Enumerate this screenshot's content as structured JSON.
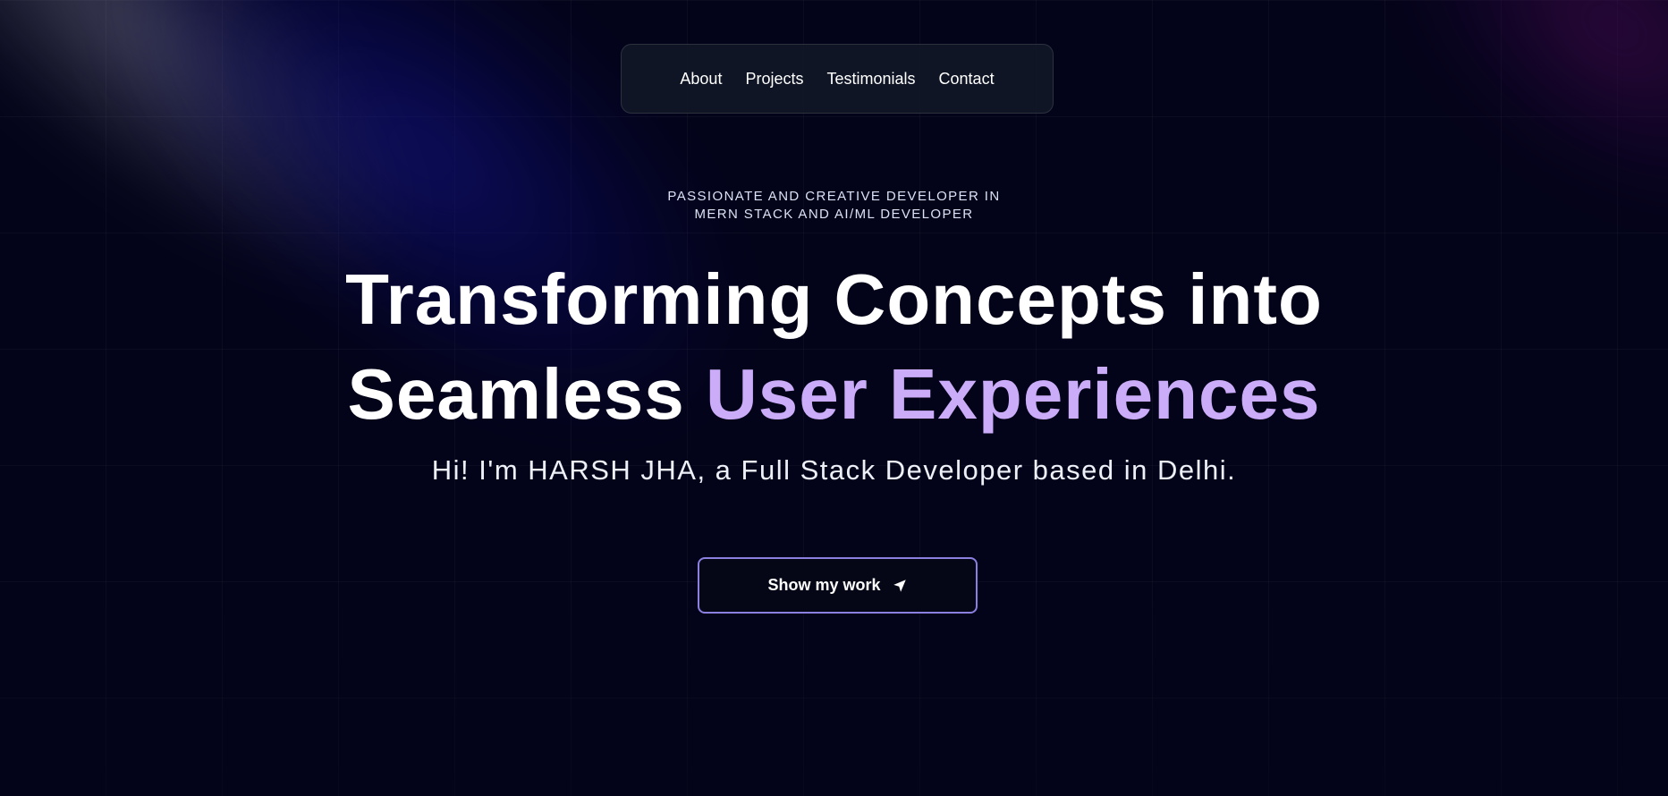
{
  "nav": {
    "items": [
      {
        "label": "About"
      },
      {
        "label": "Projects"
      },
      {
        "label": "Testimonials"
      },
      {
        "label": "Contact"
      }
    ]
  },
  "hero": {
    "tagline_line1": "PASSIONATE AND CREATIVE DEVELOPER IN",
    "tagline_line2": "MERN STACK AND AI/ML DEVELOPER",
    "headline_line1": "Transforming Concepts into",
    "headline_line2_plain": "Seamless",
    "headline_line2_accent": "User Experiences",
    "intro": "Hi! I'm HARSH JHA, a Full Stack Developer based in Delhi.",
    "cta_label": "Show my work",
    "cta_icon": "navigation-arrow-icon"
  },
  "colors": {
    "background": "#030319",
    "accent_purple": "#cbacf9",
    "button_border": "#8b7fe0",
    "navbar_bg": "#111827"
  }
}
